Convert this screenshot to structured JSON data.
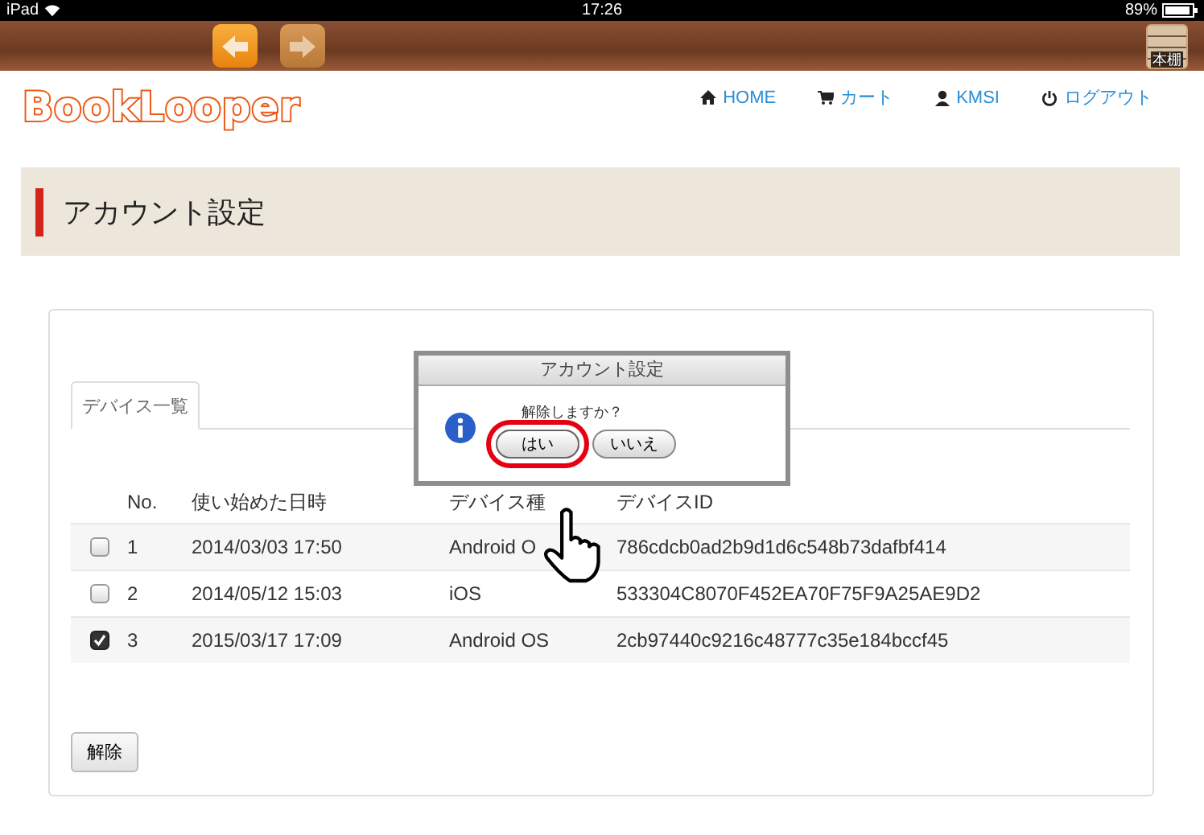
{
  "status_bar": {
    "device": "iPad",
    "time": "17:26",
    "battery": "89%"
  },
  "toolbar": {
    "shelf_label": "本棚"
  },
  "header": {
    "logo": "BookLooper",
    "nav": [
      {
        "label": "HOME"
      },
      {
        "label": "カート"
      },
      {
        "label": "KMSI"
      },
      {
        "label": "ログアウト"
      }
    ]
  },
  "page_title": "アカウント設定",
  "tabs": [
    {
      "label": "デバイス一覧",
      "selected": true
    }
  ],
  "table": {
    "columns": [
      "No.",
      "使い始めた日時",
      "デバイス種",
      "デバイスID"
    ],
    "rows": [
      {
        "checked": false,
        "cells": [
          "1",
          "2014/03/03 17:50",
          "Android O",
          "786cdcb0ad2b9d1d6c548b73dafbf414"
        ]
      },
      {
        "checked": false,
        "cells": [
          "2",
          "2014/05/12 15:03",
          "iOS",
          "533304C8070F452EA70F75F9A25AE9D2"
        ]
      },
      {
        "checked": true,
        "cells": [
          "3",
          "2015/03/17 17:09",
          "Android OS",
          "2cb97440c9216c48777c35e184bccf45"
        ]
      }
    ]
  },
  "release_button": "解除",
  "dialog": {
    "title": "アカウント設定",
    "message": "解除しますか？",
    "buttons": [
      {
        "label": "はい",
        "selected": true
      },
      {
        "label": "いいえ",
        "selected": false
      }
    ]
  }
}
